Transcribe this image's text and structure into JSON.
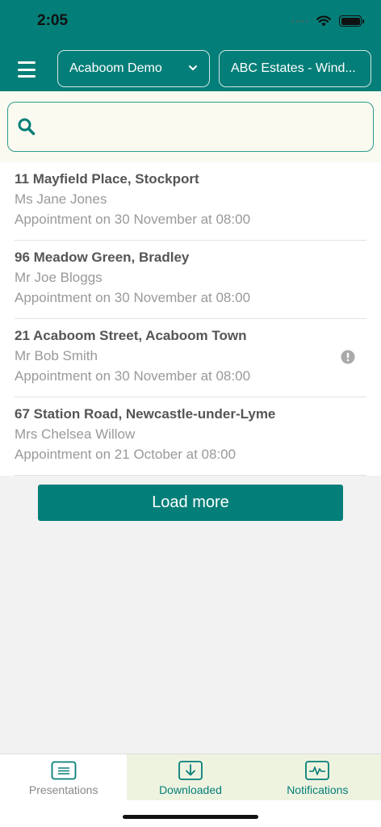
{
  "status_bar": {
    "time": "2:05"
  },
  "header": {
    "dropdown_company": {
      "value": "Acaboom Demo"
    },
    "dropdown_client": {
      "value": "ABC Estates - Wind..."
    }
  },
  "search": {
    "value": "",
    "placeholder": ""
  },
  "appointments": [
    {
      "address": "11 Mayfield Place, Stockport",
      "name": "Ms Jane Jones",
      "appointment": "Appointment on 30 November at 08:00"
    },
    {
      "address": "96 Meadow Green, Bradley",
      "name": "Mr Joe Bloggs",
      "appointment": "Appointment on 30 November at 08:00"
    },
    {
      "address": "21 Acaboom Street, Acaboom Town",
      "name": "Mr Bob Smith",
      "appointment": "Appointment on 30 November at 08:00",
      "alert_icon": "exclamation-circle-icon"
    },
    {
      "address": "67 Station Road, Newcastle-under-Lyme",
      "name": "Mrs Chelsea Willow",
      "appointment": "Appointment on 21 October at 08:00"
    }
  ],
  "load_more_label": "Load more",
  "tabs": [
    {
      "label": "Presentations",
      "icon": "presentation-icon",
      "active": false
    },
    {
      "label": "Downloaded",
      "icon": "download-icon",
      "active": true
    },
    {
      "label": "Notifications",
      "icon": "pulse-icon",
      "active": true
    }
  ],
  "colors": {
    "brand": "#047e78",
    "tab_active_bg": "#eef3e0",
    "search_bg": "#fafaf0"
  }
}
